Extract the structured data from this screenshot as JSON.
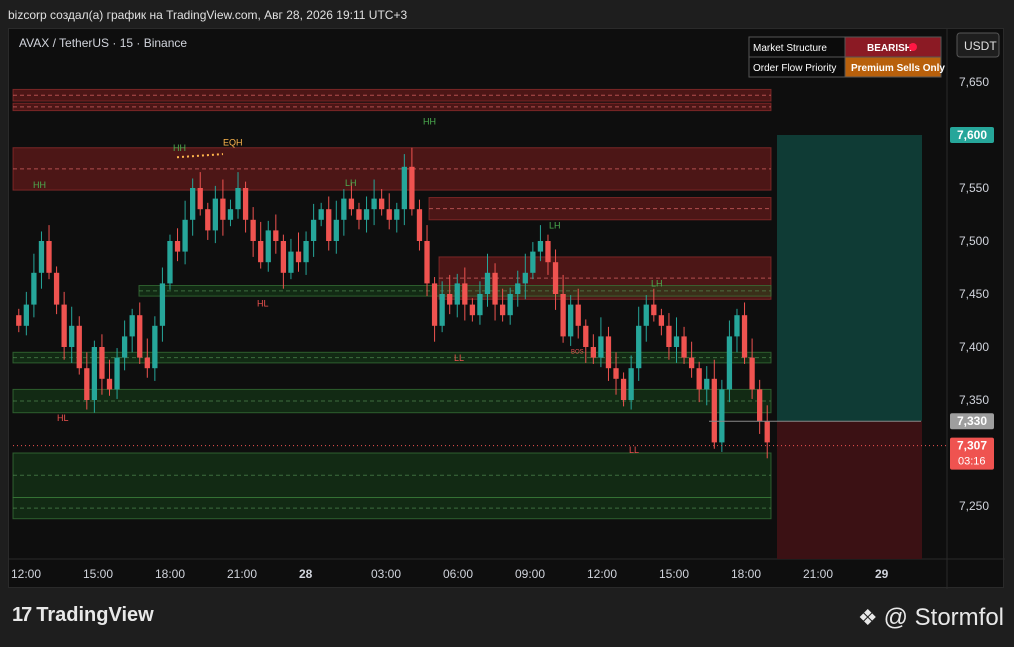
{
  "header": {
    "title": "bizcorp создал(а) график на TradingView.com, Авг 28, 2026 19:11 UTC+3"
  },
  "symbol_info": "AVAX / TetherUS · 15 · Binance",
  "currency_button": "USDT",
  "info_table": {
    "rows": [
      {
        "label": "Market Structure",
        "value": "BEARISH",
        "color": "#8b1a24"
      },
      {
        "label": "Order Flow Priority",
        "value": "Premium Sells Only",
        "color": "#b8600c"
      }
    ]
  },
  "price_badges": {
    "target": "7,600",
    "entry": "7,330",
    "last": "7,307",
    "countdown": "03:16"
  },
  "footer": {
    "logo_text": "TradingView",
    "author": "@ Stormfol"
  },
  "colors": {
    "up": "#26a69a",
    "down": "#ef5350",
    "bull_zone": "#1b5e20",
    "bear_zone": "#7f1d1d",
    "target_box": "#0f3b35",
    "stop_box": "#3b1114"
  },
  "chart_data": {
    "type": "candlestick",
    "ylim": [
      7.2,
      7.7
    ],
    "y_ticks": [
      "7,650",
      "7,600",
      "7,550",
      "7,500",
      "7,450",
      "7,400",
      "7,350",
      "7,300",
      "7,250"
    ],
    "y_tick_values": [
      7.65,
      7.6,
      7.55,
      7.5,
      7.45,
      7.4,
      7.35,
      7.3,
      7.25
    ],
    "x_ticks": [
      "12:00",
      "15:00",
      "18:00",
      "21:00",
      "28",
      "03:00",
      "06:00",
      "09:00",
      "12:00",
      "15:00",
      "18:00",
      "21:00",
      "29"
    ],
    "closes": [
      7.42,
      7.44,
      7.47,
      7.5,
      7.47,
      7.44,
      7.4,
      7.42,
      7.38,
      7.35,
      7.4,
      7.37,
      7.36,
      7.39,
      7.41,
      7.43,
      7.39,
      7.38,
      7.42,
      7.46,
      7.5,
      7.49,
      7.52,
      7.55,
      7.53,
      7.51,
      7.54,
      7.52,
      7.53,
      7.55,
      7.52,
      7.5,
      7.48,
      7.51,
      7.5,
      7.47,
      7.49,
      7.48,
      7.5,
      7.52,
      7.53,
      7.5,
      7.52,
      7.54,
      7.53,
      7.52,
      7.53,
      7.54,
      7.53,
      7.52,
      7.53,
      7.57,
      7.53,
      7.5,
      7.46,
      7.42,
      7.45,
      7.44,
      7.46,
      7.44,
      7.43,
      7.45,
      7.47,
      7.44,
      7.43,
      7.45,
      7.46,
      7.47,
      7.49,
      7.5,
      7.48,
      7.45,
      7.41,
      7.44,
      7.42,
      7.4,
      7.39,
      7.41,
      7.38,
      7.37,
      7.35,
      7.38,
      7.42,
      7.44,
      7.43,
      7.42,
      7.4,
      7.41,
      7.39,
      7.38,
      7.36,
      7.37,
      7.31,
      7.36,
      7.41,
      7.43,
      7.39,
      7.36,
      7.33,
      7.31
    ],
    "annotations": [
      {
        "text": "HH",
        "kind": "bull"
      },
      {
        "text": "HH",
        "kind": "bull"
      },
      {
        "text": "EQH",
        "kind": "eq"
      },
      {
        "text": "HH",
        "kind": "bull"
      },
      {
        "text": "LH",
        "kind": "bull"
      },
      {
        "text": "LH",
        "kind": "bull"
      },
      {
        "text": "LH",
        "kind": "bull"
      },
      {
        "text": "HL",
        "kind": "bear"
      },
      {
        "text": "HL",
        "kind": "bear"
      },
      {
        "text": "LL",
        "kind": "bear"
      },
      {
        "text": "LL",
        "kind": "bear"
      },
      {
        "text": "BOS",
        "kind": "bear"
      }
    ]
  }
}
